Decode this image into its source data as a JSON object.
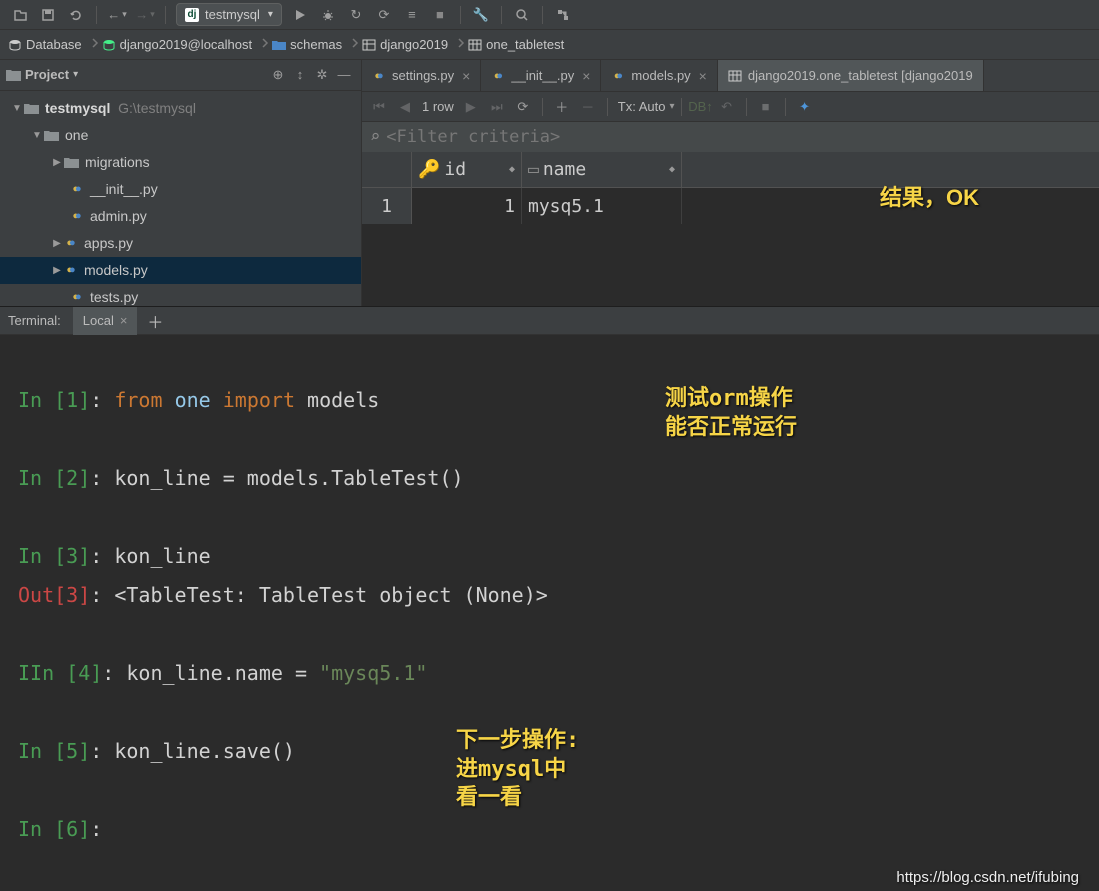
{
  "toolbar": {
    "run_config": "testmysql"
  },
  "breadcrumb": [
    "Database",
    "django2019@localhost",
    "schemas",
    "django2019",
    "one_tabletest"
  ],
  "project": {
    "title": "Project",
    "root": {
      "label": "testmysql",
      "hint": "G:\\testmysql"
    },
    "pkg": "one",
    "items": [
      "migrations",
      "__init__.py",
      "admin.py",
      "apps.py",
      "models.py",
      "tests.py"
    ]
  },
  "tabs": [
    "settings.py",
    "__init__.py",
    "models.py",
    "django2019.one_tabletest [django2019"
  ],
  "subtoolbar": {
    "rows": "1 row",
    "tx": "Tx: Auto"
  },
  "filter_placeholder": "<Filter criteria>",
  "columns": [
    "id",
    "name"
  ],
  "data_row": {
    "n": "1",
    "id": "1",
    "name": "mysq5.1"
  },
  "annot1": "结果，OK",
  "annot2_l1": "测试orm操作",
  "annot2_l2": "能否正常运行",
  "annot3_l1": "下一步操作:",
  "annot3_l2": "进mysql中",
  "annot3_l3": "看一看",
  "term": {
    "title": "Terminal:",
    "tab": "Local",
    "in": "In ",
    "out": "Out",
    "iin": "IIn ",
    "lines": {
      "l1_from": "from ",
      "l1_one": "one ",
      "l1_import": "import ",
      "l1_models": "models",
      "l2": ": kon_line = models.TableTest()",
      "l3": ": kon_line",
      "l3o": ": <TableTest: TableTest object (None)>",
      "l4a": ": kon_line.name = ",
      "l4b": "\"mysq5.1\"",
      "l5": ": kon_line.save()",
      "p1": "[1]",
      "p2": "[2]",
      "p3": "[3]",
      "p4": "[4]",
      "p5": "[5]",
      "p6": "[6]"
    }
  },
  "watermark": "https://blog.csdn.net/ifubing"
}
